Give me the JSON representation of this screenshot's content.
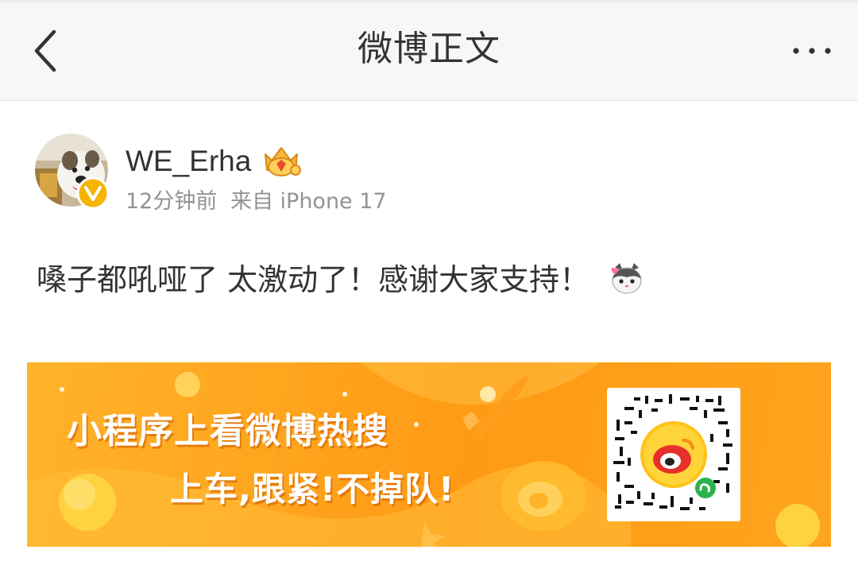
{
  "nav": {
    "title": "微博正文",
    "back_icon": "chevron-left-icon",
    "more_icon": "more-horizontal-icon"
  },
  "post": {
    "username": "WE_Erha",
    "time": "12分钟前",
    "source": "来自 iPhone 17",
    "text": "嗓子都吼哑了 太激动了！感谢大家支持！",
    "emoji_icon": "cat-love-emoji-icon",
    "badges": [
      "verified-v-icon",
      "crown-medal-icon"
    ]
  },
  "banner": {
    "line1": "小程序上看微博热搜",
    "line2": "上车,跟紧!不掉队!",
    "qr_icon": "weibo-miniprogram-qr-icon"
  },
  "colors": {
    "accent": "#ff9a14",
    "verified": "#f5b400",
    "text": "#333333",
    "meta": "#939393"
  }
}
